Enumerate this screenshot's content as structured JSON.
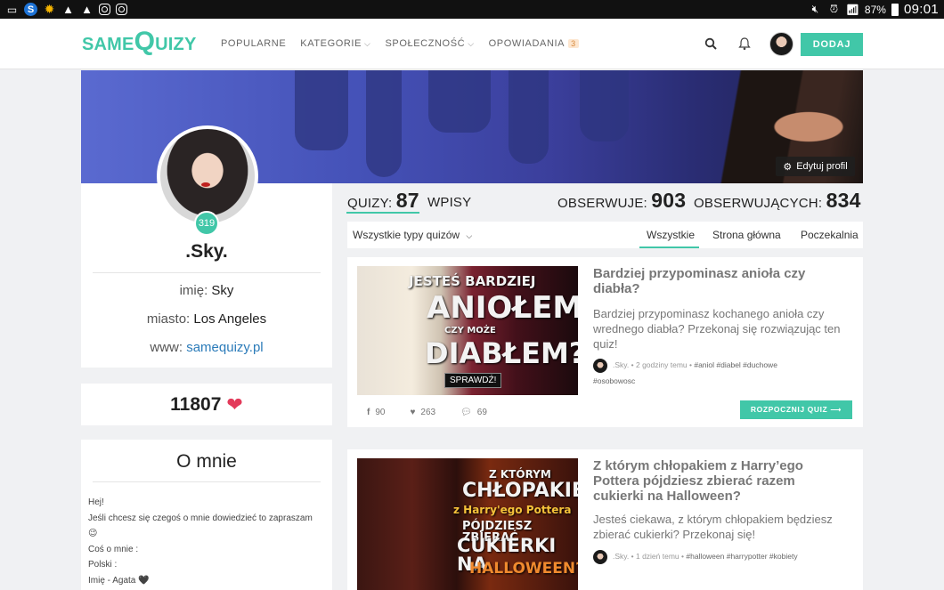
{
  "status_bar": {
    "battery": "87%",
    "time": "09:01"
  },
  "nav": {
    "logo_same": "SAME",
    "logo_q": "Q",
    "logo_uizy": "UIZY",
    "items": [
      {
        "label": "POPULARNE"
      },
      {
        "label": "KATEGORIE"
      },
      {
        "label": "SPOŁECZNOŚĆ"
      },
      {
        "label": "OPOWIADANIA",
        "badge": "3"
      }
    ],
    "add_button": "DODAJ"
  },
  "banner": {
    "edit_label": "Edytuj profil"
  },
  "profile": {
    "level": "319",
    "name": ".Sky.",
    "imie_label": "imię:",
    "imie_value": "Sky",
    "miasto_label": "miasto:",
    "miasto_value": "Los Angeles",
    "www_label": "www:",
    "www_value": "samequizy.pl",
    "hearts": "11807"
  },
  "about": {
    "title": "O mnie",
    "lines": [
      "Hej!",
      "Jeśli chcesz się czegoś o mnie dowiedzieć to zapraszam",
      "😉",
      "Coś o mnie :",
      "Polski :",
      "Imię - Agata 🖤"
    ]
  },
  "stats": {
    "quizy_label": "QUIZY:",
    "quizy_value": "87",
    "wpisy_label": "WPISY",
    "obserwuje_label": "OBSERWUJE:",
    "obserwuje_value": "903",
    "obserwujacych_label": "OBSERWUJĄCYCH:",
    "obserwujacych_value": "834"
  },
  "filter": {
    "type_select": "Wszystkie typy quizów",
    "tabs": [
      "Wszystkie",
      "Strona główna",
      "Poczekalnia"
    ]
  },
  "quizzes": [
    {
      "image_text": {
        "l1": "JESTEŚ BARDZIEJ",
        "l2": "ANIOŁEM",
        "l3": "CZY MOŻE",
        "l4": "DIABŁEM?",
        "btn": "SPRAWDŹ!"
      },
      "title": "Bardziej przypominasz anioła czy diabła?",
      "desc": "Bardziej przypominasz kochanego anioła czy wrednego diabła? Przekonaj się rozwiązując ten quiz!",
      "author": ".Sky.",
      "time": "• 2 godziny temu •",
      "tags": "#aniol #diabel #duchowe",
      "tags2": "#osobowosc",
      "fb": "90",
      "likes": "263",
      "comments": "69",
      "start": "ROZPOCZNIJ QUIZ ⟶"
    },
    {
      "image_text": {
        "l1": "Z KTÓRYM",
        "l2": "CHŁOPAKIEM",
        "l3": "z Harry'ego Pottera",
        "l4": "PÓJDZIESZ ZBIERAĆ",
        "l5": "CUKIERKI NA",
        "l6": "HALLOWEEN?"
      },
      "title": "Z którym chłopakiem z Harry’ego Pottera pójdziesz zbierać razem cukierki na Halloween?",
      "desc": "Jesteś ciekawa, z którym chłopakiem będziesz zbierać cukierki? Przekonaj się!",
      "author": ".Sky.",
      "time": "• 1 dzień temu •",
      "tags": "#halloween #harrypotter #kobiety"
    }
  ]
}
